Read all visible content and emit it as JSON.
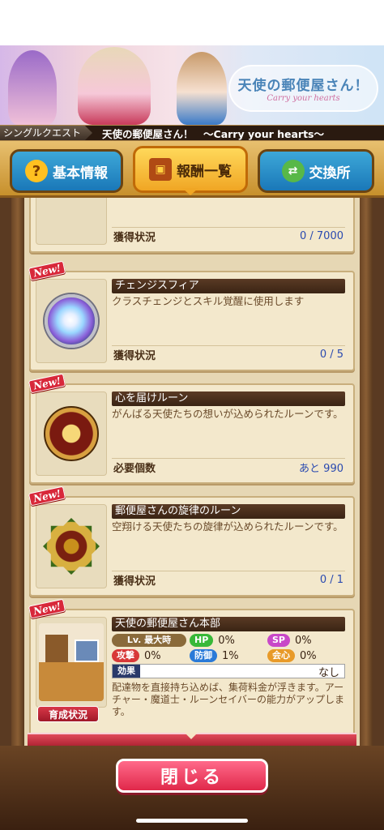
{
  "banner": {
    "logo_title": "天使の郵便屋さん！",
    "logo_sub": "Carry your hearts"
  },
  "quest": {
    "tag": "シングルクエスト",
    "title": "天使の郵便屋さん！　～Carry your hearts～"
  },
  "tabs": [
    {
      "label": "基本情報",
      "icon": "question-icon"
    },
    {
      "label": "報酬一覧",
      "icon": "treasure-chest-icon"
    },
    {
      "label": "交換所",
      "icon": "exchange-icon"
    }
  ],
  "items": [
    {
      "name": "",
      "desc": "",
      "stat_label": "獲得状況",
      "stat_value": "0 / 7000",
      "new": false
    },
    {
      "name": "チェンジスフィア",
      "desc": "クラスチェンジとスキル覚醒に使用します",
      "stat_label": "獲得状況",
      "stat_value": "0 / 5",
      "new": true,
      "new_label": "New!"
    },
    {
      "name": "心を届けルーン",
      "desc": "がんばる天使たちの想いが込められたルーンです。",
      "stat_label": "必要個数",
      "stat_value": "あと 990",
      "new": true,
      "new_label": "New!"
    },
    {
      "name": "郵便屋さんの旋律のルーン",
      "desc": "空翔ける天使たちの旋律が込められたルーンです。",
      "stat_label": "獲得状況",
      "stat_value": "0 / 1",
      "new": true,
      "new_label": "New!"
    }
  ],
  "building": {
    "new_label": "New!",
    "name": "天使の郵便屋さん本部",
    "level_label": "Lv. 最大時",
    "hp_label": "HP",
    "hp_value": "0%",
    "sp_label": "SP",
    "sp_value": "0%",
    "atk_label": "攻撃",
    "atk_value": "0%",
    "def_label": "防御",
    "def_value": "1%",
    "crit_label": "会心",
    "crit_value": "0%",
    "effect_label": "効果",
    "effect_value": "なし",
    "desc": "配達物を直接持ち込めば、集荷料金が浮きます。アーチャー・魔道士・ルーンセイバーの能力がアップします。",
    "grow_button": "育成状況"
  },
  "footer": {
    "close_label": "閉じる"
  }
}
